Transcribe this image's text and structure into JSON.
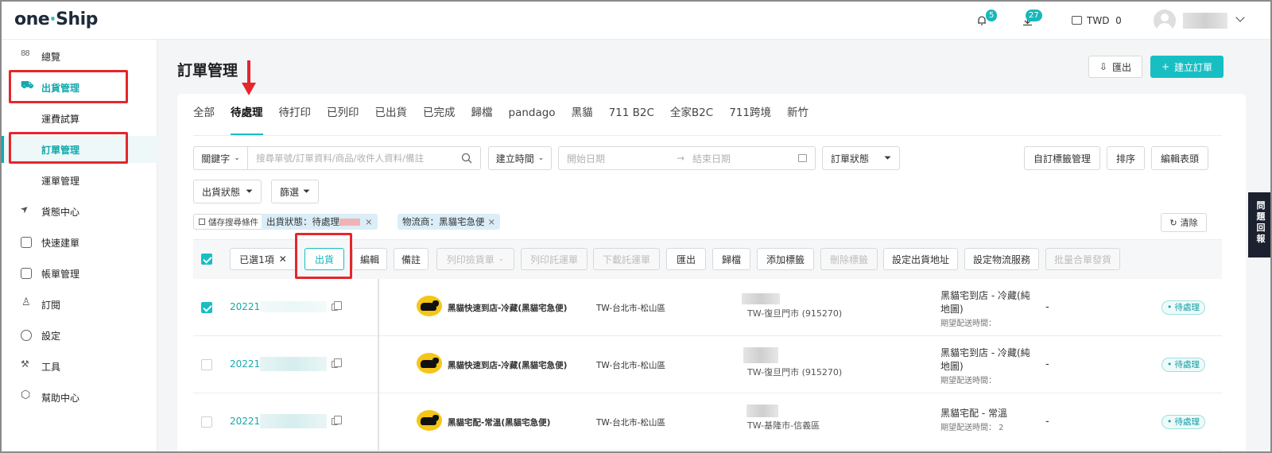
{
  "app": {
    "logo_main": "one",
    "logo_sub": "Ship"
  },
  "topbar": {
    "notifications_count": "5",
    "downloads_count": "27",
    "wallet_label": "TWD",
    "wallet_amount": "0"
  },
  "sidebar": {
    "items": [
      {
        "label": "總覽",
        "icon": "grid-icon"
      },
      {
        "label": "出貨管理",
        "icon": "shipping-icon"
      },
      {
        "label": "運費試算",
        "icon": ""
      },
      {
        "label": "訂單管理",
        "icon": ""
      },
      {
        "label": "運單管理",
        "icon": ""
      },
      {
        "label": "貨態中心",
        "icon": "send-icon"
      },
      {
        "label": "快速建單",
        "icon": "bag-icon"
      },
      {
        "label": "帳單管理",
        "icon": "bill-icon"
      },
      {
        "label": "訂閱",
        "icon": "user-icon"
      },
      {
        "label": "設定",
        "icon": "settings-icon"
      },
      {
        "label": "工具",
        "icon": "tools-icon"
      },
      {
        "label": "幫助中心",
        "icon": "box-icon"
      }
    ]
  },
  "page": {
    "title": "訂單管理",
    "export_label": "匯出",
    "create_label": "建立訂單"
  },
  "tabs": [
    "全部",
    "待處理",
    "待打印",
    "已列印",
    "已出貨",
    "已完成",
    "歸檔",
    "pandago",
    "黑貓",
    "711 B2C",
    "全家B2C",
    "711跨境",
    "新竹"
  ],
  "filters": {
    "keyword_label": "關鍵字",
    "search_placeholder": "搜尋單號/訂單資料/商品/收件人資料/備註",
    "time_label": "建立時間",
    "start_placeholder": "開始日期",
    "end_placeholder": "結束日期",
    "order_status_label": "訂單狀態",
    "custom_tag_label": "自訂標籤管理",
    "sort_label": "排序",
    "edit_header_label": "編輯表頭",
    "ship_status_label": "出貨狀態",
    "filter_label": "篩選",
    "save_search_label": "儲存搜尋條件",
    "chip_ship_status": "出貨狀態：待處理",
    "chip_carrier": "物流商：黑貓宅急便",
    "clear_label": "清除"
  },
  "toolbar": {
    "selected_label": "已選1項",
    "buttons": [
      "出貨",
      "編輯",
      "備註",
      "列印撿貨單",
      "列印託運單",
      "下載託運單",
      "匯出",
      "歸檔",
      "添加標籤",
      "刪除標籤",
      "設定出貨地址",
      "設定物流服務",
      "批量合單發貨"
    ]
  },
  "rows": [
    {
      "order_no": "20221",
      "service": "黑貓快速到店-冷藏(黑貓宅急便)",
      "region": "TW-台北市-松山區",
      "store": "TW-復旦門市 (915270)",
      "delivery": "黑貓宅到店 - 冷藏(純",
      "delivery2": "地圖)",
      "expected": "期望配送時間：",
      "dash": "-",
      "status": "• 待處理",
      "checked": true
    },
    {
      "order_no": "20221",
      "service": "黑貓快速到店-冷藏(黑貓宅急便)",
      "region": "TW-台北市-松山區",
      "store": "TW-復旦門市 (915270)",
      "delivery": "黑貓宅到店 - 冷藏(純",
      "delivery2": "地圖)",
      "expected": "期望配送時間：",
      "dash": "-",
      "status": "• 待處理",
      "checked": false
    },
    {
      "order_no": "20221",
      "service": "黑貓宅配-常溫(黑貓宅急便)",
      "region": "TW-台北市-松山區",
      "store": "TW-基隆市-信義區",
      "delivery": "黑貓宅配 - 常溫",
      "delivery2": "",
      "expected": "期望配送時間： 2",
      "dash": "-",
      "status": "• 待處理",
      "checked": false
    }
  ],
  "help_tab": {
    "l1": "問",
    "l2": "題",
    "l3": "回",
    "l4": "報"
  },
  "colors": {
    "accent": "#17bfc3",
    "annotation": "#e5262b"
  }
}
